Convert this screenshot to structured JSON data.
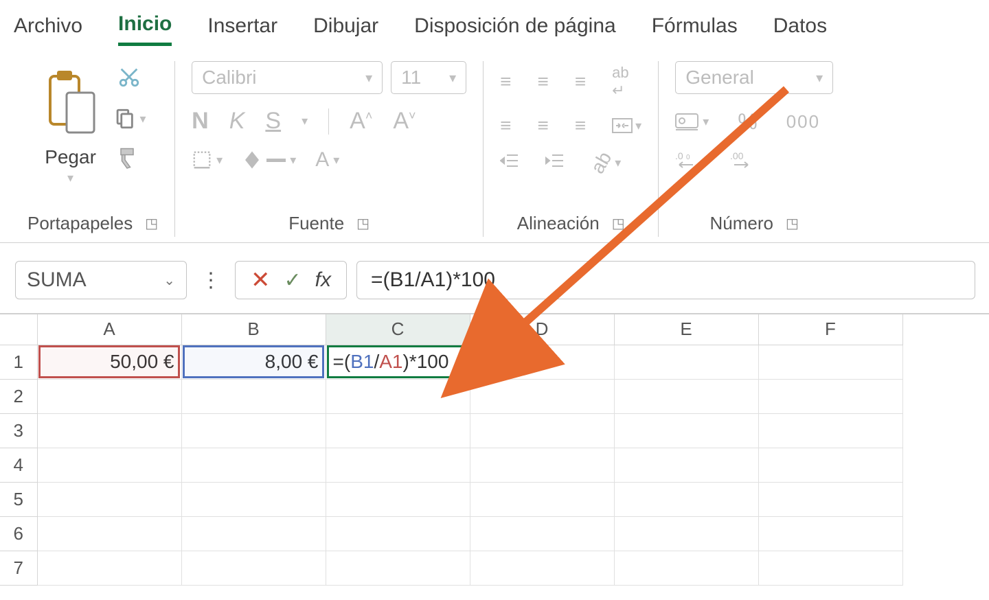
{
  "tabs": {
    "file": "Archivo",
    "home": "Inicio",
    "insert": "Insertar",
    "draw": "Dibujar",
    "layout": "Disposición de página",
    "formulas": "Fórmulas",
    "data": "Datos"
  },
  "ribbon": {
    "clipboard": {
      "paste": "Pegar",
      "group": "Portapapeles"
    },
    "font": {
      "group": "Fuente",
      "name": "Calibri",
      "size": "11",
      "bold": "N",
      "italic": "K",
      "underline": "S",
      "grow": "Aˆ",
      "shrink": "Aˇ"
    },
    "align": {
      "group": "Alineación"
    },
    "number": {
      "group": "Número",
      "format": "General",
      "percent": "%",
      "thousands": "000",
      "dec_inc": ".0←",
      "dec_dec": ".00→"
    }
  },
  "fx": {
    "name_box": "SUMA",
    "fx_label": "fx",
    "formula": "=(B1/A1)*100"
  },
  "grid": {
    "cols": [
      "A",
      "B",
      "C",
      "D",
      "E",
      "F"
    ],
    "rows": [
      "1",
      "2",
      "3",
      "4",
      "5",
      "6",
      "7"
    ],
    "a1": "50,00 €",
    "b1": "8,00 €",
    "c1_parts": {
      "eq": "=(",
      "b1": "B1",
      "slash": "/",
      "a1": "A1",
      "tail": ")*100"
    }
  },
  "colors": {
    "accent": "#107c41",
    "arrow": "#e86a2e"
  }
}
